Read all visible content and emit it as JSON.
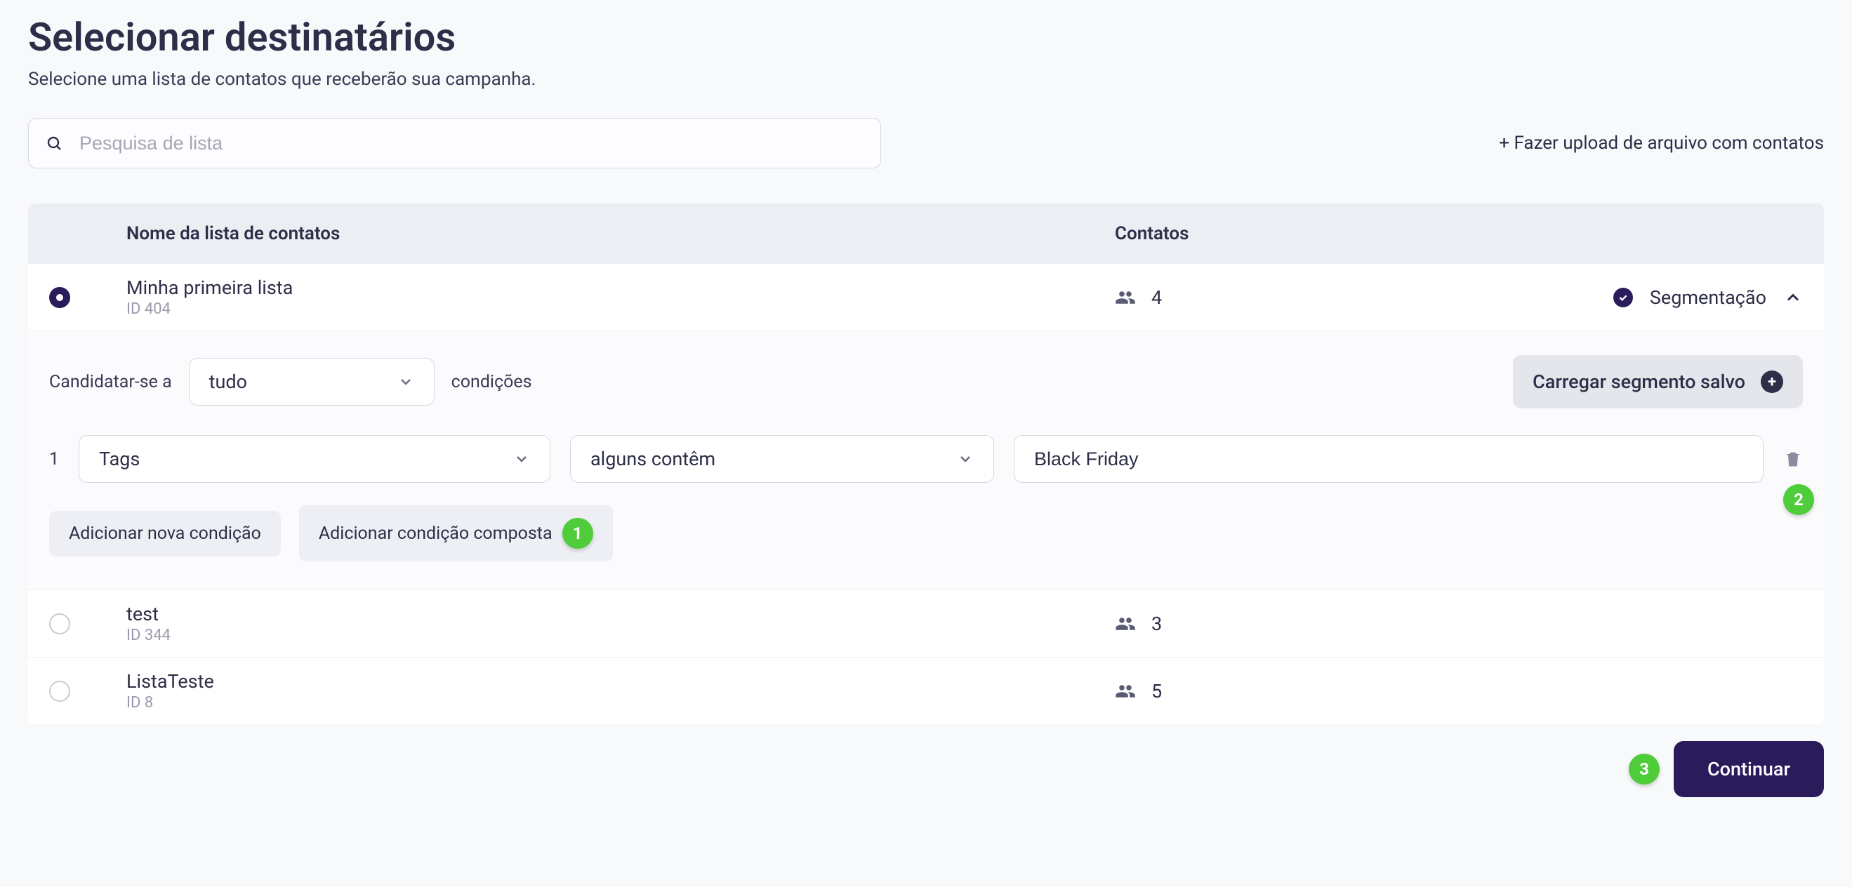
{
  "page": {
    "title": "Selecionar destinatários",
    "subtitle": "Selecione uma lista de contatos que receberão sua campanha."
  },
  "search": {
    "placeholder": "Pesquisa de lista"
  },
  "upload_link": "+ Fazer upload de arquivo com contatos",
  "table": {
    "header_name": "Nome da lista de contatos",
    "header_contacts": "Contatos"
  },
  "rows": [
    {
      "selected": true,
      "name": "Minha primeira lista",
      "id": "ID 404",
      "contacts": "4",
      "seg_label": "Segmentação",
      "expanded": true,
      "seg_applied": true
    },
    {
      "selected": false,
      "name": "test",
      "id": "ID 344",
      "contacts": "3"
    },
    {
      "selected": false,
      "name": "ListaTeste",
      "id": "ID 8",
      "contacts": "5"
    }
  ],
  "segmentation": {
    "apply_prefix": "Candidatar-se a",
    "apply_mode": "tudo",
    "apply_suffix": "condições",
    "load_saved": "Carregar segmento salvo",
    "condition": {
      "index": "1",
      "field": "Tags",
      "operator": "alguns contêm",
      "value": "Black Friday"
    },
    "add_condition": "Adicionar nova condição",
    "add_composite": "Adicionar condição composta"
  },
  "steps": {
    "one": "1",
    "two": "2",
    "three": "3"
  },
  "footer": {
    "continue": "Continuar"
  }
}
